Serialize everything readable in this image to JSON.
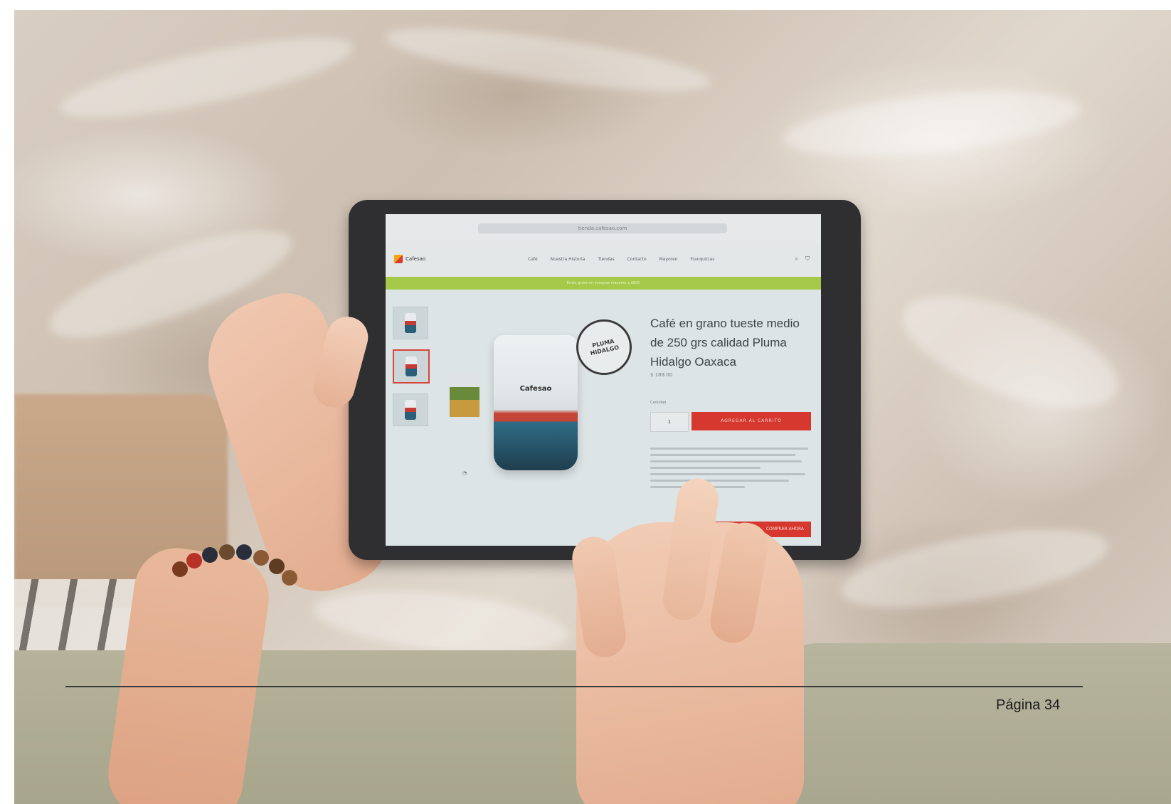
{
  "browser": {
    "url": "tienda.cafesao.com"
  },
  "site": {
    "logo_text": "Cafesao",
    "nav": [
      "Café",
      "Nuestra Historia",
      "Tiendas",
      "Contacto",
      "Mayoreo",
      "Franquicias"
    ],
    "promo": "Envío gratis en compras mayores a $500"
  },
  "product": {
    "title": "Café en grano tueste medio de 250 grs calidad Pluma Hidalgo Oaxaca",
    "price": "$ 189.00",
    "qty_label": "Cantidad",
    "qty": "1",
    "add_to_cart": "AGREGAR AL CARRITO",
    "buy_now": "COMPRAR AHORA",
    "bag_brand": "Cafesao",
    "seal": "PLUMA HIDALGO"
  },
  "page": {
    "number_label": "Página 34"
  },
  "colors": {
    "accent_red": "#d6382f",
    "promo_green": "#a6c94a"
  }
}
